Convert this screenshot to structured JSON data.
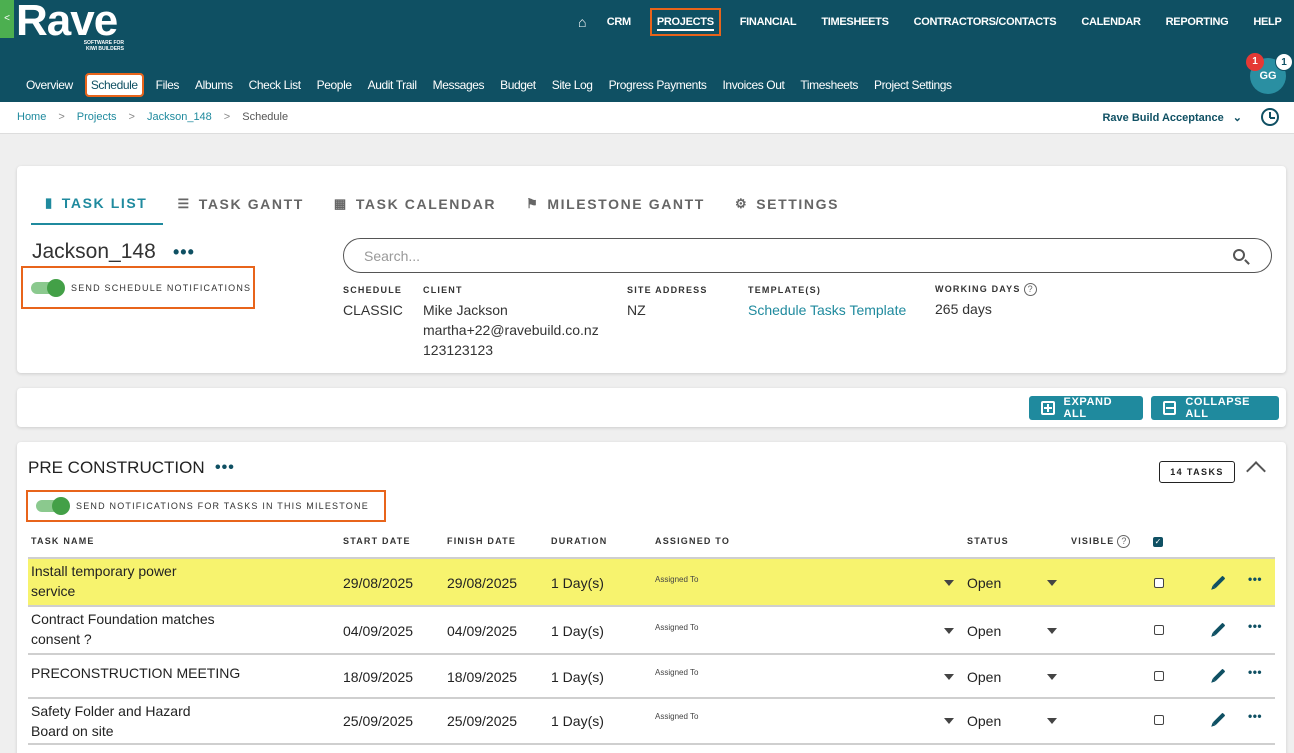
{
  "brand": {
    "name": "Rave",
    "tagline_1": "SOFTWARE FOR",
    "tagline_2": "KIWI BUILDERS",
    "side_tab": "<"
  },
  "main_nav": {
    "home_icon": "home-icon",
    "items": [
      "CRM",
      "PROJECTS",
      "FINANCIAL",
      "TIMESHEETS",
      "CONTRACTORS/CONTACTS",
      "CALENDAR",
      "REPORTING",
      "HELP"
    ],
    "active": "PROJECTS"
  },
  "sub_nav": {
    "items": [
      "Overview",
      "Schedule",
      "Files",
      "Albums",
      "Check List",
      "People",
      "Audit Trail",
      "Messages",
      "Budget",
      "Site Log",
      "Progress Payments",
      "Invoices Out",
      "Timesheets",
      "Project Settings"
    ],
    "active": "Schedule"
  },
  "user": {
    "initials": "GG",
    "notifications": "1",
    "messages": "1"
  },
  "breadcrumb": {
    "items": [
      "Home",
      "Projects",
      "Jackson_148",
      "Schedule"
    ],
    "separator": ">"
  },
  "company_selector": {
    "label": "Rave Build Acceptance"
  },
  "tabs": [
    {
      "label": "TASK LIST",
      "icon": "clipboard-icon"
    },
    {
      "label": "TASK GANTT",
      "icon": "list-icon"
    },
    {
      "label": "TASK CALENDAR",
      "icon": "calendar-icon"
    },
    {
      "label": "MILESTONE GANTT",
      "icon": "flag-icon"
    },
    {
      "label": "SETTINGS",
      "icon": "gears-icon"
    }
  ],
  "project": {
    "title": "Jackson_148",
    "menu": "•••",
    "notify_label": "SEND SCHEDULE NOTIFICATIONS",
    "search_placeholder": "Search...",
    "schedule_label": "SCHEDULE",
    "schedule_value": "CLASSIC",
    "client_label": "CLIENT",
    "client_name": "Mike Jackson",
    "client_email": "martha+22@ravebuild.co.nz",
    "client_phone": "123123123",
    "site_label": "SITE ADDRESS",
    "site_value": "NZ",
    "template_label": "TEMPLATE(S)",
    "template_value": "Schedule Tasks Template",
    "working_label": "WORKING DAYS",
    "working_value": "265 days"
  },
  "actions": {
    "expand": "EXPAND ALL",
    "collapse": "COLLAPSE ALL"
  },
  "milestone": {
    "title": "PRE CONSTRUCTION",
    "menu": "•••",
    "tasks_count": "14 TASKS",
    "notify_label": "SEND NOTIFICATIONS FOR TASKS IN THIS MILESTONE",
    "columns": {
      "task": "TASK NAME",
      "start": "START DATE",
      "finish": "FINISH DATE",
      "duration": "DURATION",
      "assigned": "ASSIGNED TO",
      "status": "STATUS",
      "visible": "VISIBLE"
    },
    "rows": [
      {
        "name": "Install temporary power service",
        "start": "29/08/2025",
        "finish": "29/08/2025",
        "duration": "1 Day(s)",
        "assigned": "Assigned To",
        "status": "Open",
        "highlight": true
      },
      {
        "name": "Contract Foundation matches consent ?",
        "start": "04/09/2025",
        "finish": "04/09/2025",
        "duration": "1 Day(s)",
        "assigned": "Assigned To",
        "status": "Open",
        "highlight": false
      },
      {
        "name": "PRECONSTRUCTION MEETING",
        "start": "18/09/2025",
        "finish": "18/09/2025",
        "duration": "1 Day(s)",
        "assigned": "Assigned To",
        "status": "Open",
        "highlight": false
      },
      {
        "name": "Safety Folder and Hazard Board on site",
        "start": "25/09/2025",
        "finish": "25/09/2025",
        "duration": "1 Day(s)",
        "assigned": "Assigned To",
        "status": "Open",
        "highlight": false
      }
    ]
  },
  "colors": {
    "header": "#0f5063",
    "accent": "#1f8a9e",
    "highlight": "#f7f36e",
    "outline": "#e8641b",
    "toggle": "#43a047"
  }
}
